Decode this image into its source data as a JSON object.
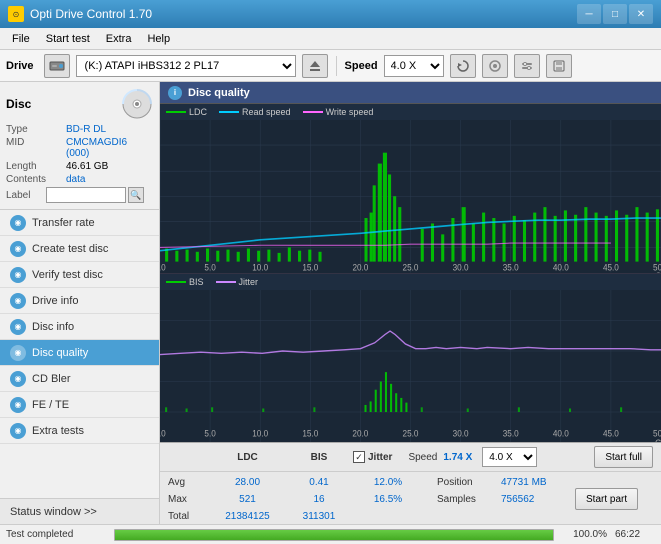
{
  "window": {
    "title": "Opti Drive Control 1.70",
    "icon": "⊙"
  },
  "menu": {
    "items": [
      "File",
      "Start test",
      "Extra",
      "Help"
    ]
  },
  "toolbar": {
    "drive_label": "Drive",
    "drive_value": "(K:) ATAPI iHBS312  2 PL17",
    "speed_label": "Speed",
    "speed_value": "4.0 X"
  },
  "disc": {
    "section_title": "Disc",
    "type_label": "Type",
    "type_value": "BD-R DL",
    "mid_label": "MID",
    "mid_value": "CMCMAGDI6 (000)",
    "length_label": "Length",
    "length_value": "46.61 GB",
    "contents_label": "Contents",
    "contents_value": "data",
    "label_label": "Label",
    "label_value": ""
  },
  "sidebar_nav": [
    {
      "id": "transfer-rate",
      "label": "Transfer rate",
      "active": false
    },
    {
      "id": "create-test-disc",
      "label": "Create test disc",
      "active": false
    },
    {
      "id": "verify-test-disc",
      "label": "Verify test disc",
      "active": false
    },
    {
      "id": "drive-info",
      "label": "Drive info",
      "active": false
    },
    {
      "id": "disc-info",
      "label": "Disc info",
      "active": false
    },
    {
      "id": "disc-quality",
      "label": "Disc quality",
      "active": true
    },
    {
      "id": "cd-bler",
      "label": "CD Bler",
      "active": false
    },
    {
      "id": "fe-te",
      "label": "FE / TE",
      "active": false
    },
    {
      "id": "extra-tests",
      "label": "Extra tests",
      "active": false
    }
  ],
  "status_window": "Status window >>",
  "panel": {
    "title": "Disc quality",
    "icon": "i"
  },
  "chart1": {
    "legend": [
      {
        "label": "LDC",
        "color": "#00cc00"
      },
      {
        "label": "Read speed",
        "color": "#00ccff"
      },
      {
        "label": "Write speed",
        "color": "#ff66ff"
      }
    ],
    "y_max": 600,
    "y_right_max": 18,
    "x_max": 50,
    "x_unit": "GB",
    "y_right_unit": "X"
  },
  "chart2": {
    "legend": [
      {
        "label": "BIS",
        "color": "#00cc00"
      },
      {
        "label": "Jitter",
        "color": "#cc88ff"
      }
    ],
    "y_max": 20,
    "y_right_max": 20,
    "x_max": 50,
    "x_unit": "GB",
    "y_right_unit": "%"
  },
  "stats": {
    "headers": [
      "LDC",
      "BIS",
      "",
      "Jitter",
      "Speed",
      "1.74 X",
      "",
      "4.0 X"
    ],
    "avg_label": "Avg",
    "avg_ldc": "28.00",
    "avg_bis": "0.41",
    "avg_jitter": "12.0%",
    "max_label": "Max",
    "max_ldc": "521",
    "max_bis": "16",
    "max_jitter": "16.5%",
    "total_label": "Total",
    "total_ldc": "21384125",
    "total_bis": "311301",
    "position_label": "Position",
    "position_value": "47731 MB",
    "samples_label": "Samples",
    "samples_value": "756562",
    "start_full_label": "Start full",
    "start_part_label": "Start part",
    "speed_label": "Speed",
    "speed_value": "1.74 X",
    "speed_select": "4.0 X"
  },
  "statusbar": {
    "text": "Test completed",
    "progress": 100,
    "percent": "100.0%",
    "time": "66:22"
  }
}
